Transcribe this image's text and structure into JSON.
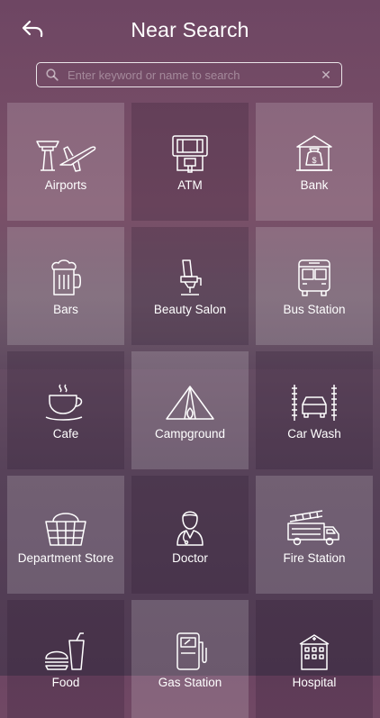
{
  "header": {
    "title": "Near Search",
    "back_icon": "back-arrow-icon"
  },
  "search": {
    "placeholder": "Enter keyword or name to search",
    "value": "",
    "clear_label": "✕"
  },
  "categories": [
    {
      "label": "Airports",
      "icon": "airport-icon"
    },
    {
      "label": "ATM",
      "icon": "atm-icon"
    },
    {
      "label": "Bank",
      "icon": "bank-icon"
    },
    {
      "label": "Bars",
      "icon": "beer-mug-icon"
    },
    {
      "label": "Beauty Salon",
      "icon": "salon-chair-icon"
    },
    {
      "label": "Bus Station",
      "icon": "bus-icon"
    },
    {
      "label": "Cafe",
      "icon": "coffee-cup-icon"
    },
    {
      "label": "Campground",
      "icon": "tent-icon"
    },
    {
      "label": "Car Wash",
      "icon": "car-wash-icon"
    },
    {
      "label": "Department Store",
      "icon": "basket-icon"
    },
    {
      "label": "Doctor",
      "icon": "doctor-icon"
    },
    {
      "label": "Fire Station",
      "icon": "fire-truck-icon"
    },
    {
      "label": "Food",
      "icon": "burger-drink-icon"
    },
    {
      "label": "Gas Station",
      "icon": "gas-pump-icon"
    },
    {
      "label": "Hospital",
      "icon": "hospital-icon"
    }
  ],
  "colors": {
    "background_top": "#6e4663",
    "background_bottom": "#4f3a52",
    "text": "#ffffff"
  }
}
